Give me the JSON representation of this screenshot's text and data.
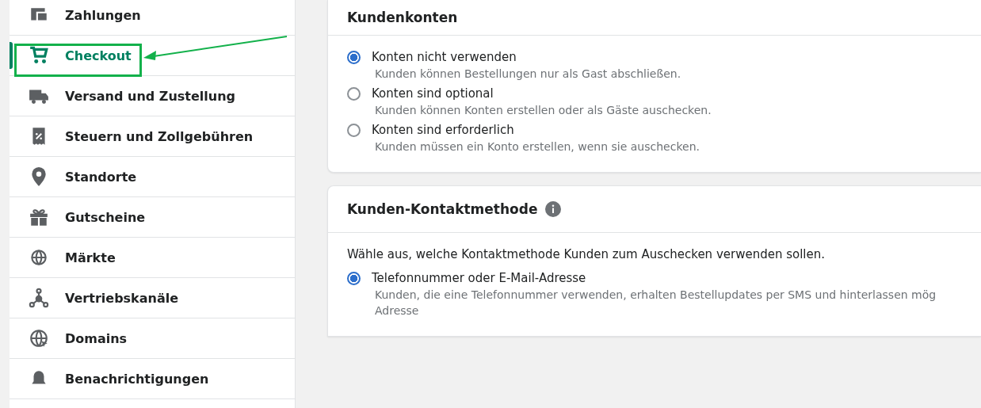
{
  "sidebar": {
    "items": [
      {
        "label": "Zahlungen",
        "selected": false
      },
      {
        "label": "Checkout",
        "selected": true
      },
      {
        "label": "Versand und Zustellung",
        "selected": false
      },
      {
        "label": "Steuern und Zollgebühren",
        "selected": false
      },
      {
        "label": "Standorte",
        "selected": false
      },
      {
        "label": "Gutscheine",
        "selected": false
      },
      {
        "label": "Märkte",
        "selected": false
      },
      {
        "label": "Vertriebskanäle",
        "selected": false
      },
      {
        "label": "Domains",
        "selected": false
      },
      {
        "label": "Benachrichtigungen",
        "selected": false
      }
    ]
  },
  "cards": [
    {
      "title": "Kundenkonten",
      "info": false,
      "options": [
        {
          "label": "Konten nicht verwenden",
          "selected": true,
          "description_lines": [
            "Kunden können Bestellungen nur als Gast abschließen."
          ]
        },
        {
          "label": "Konten sind optional",
          "selected": false,
          "description_lines": [
            "Kunden können Konten erstellen oder als Gäste auschecken."
          ]
        },
        {
          "label": "Konten sind erforderlich",
          "selected": false,
          "description_lines": [
            "Kunden müssen ein Konto erstellen, wenn sie auschecken."
          ]
        }
      ]
    },
    {
      "title": "Kunden-Kontaktmethode",
      "info": true,
      "intro": "Wähle aus, welche Kontaktmethode Kunden zum Auschecken verwenden sollen.",
      "options": [
        {
          "label": "Telefonnummer oder E-Mail-Adresse",
          "selected": true,
          "description_lines": [
            "Kunden, die eine Telefonnummer verwenden, erhalten Bestellupdates per SMS und hinterlassen mög",
            "Adresse"
          ]
        }
      ]
    }
  ]
}
